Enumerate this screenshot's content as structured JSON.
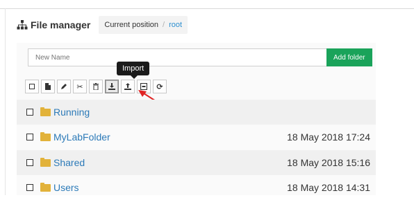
{
  "header": {
    "title": "File manager",
    "breadcrumb": {
      "label": "Current position",
      "separator": "/",
      "current": "root"
    }
  },
  "new_folder": {
    "placeholder": "New Name",
    "button_label": "Add folder"
  },
  "toolbar": {
    "tooltip": "Import",
    "buttons": [
      {
        "icon": "checkbox-icon"
      },
      {
        "icon": "new-file-icon"
      },
      {
        "icon": "pencil-icon"
      },
      {
        "icon": "scissors-icon"
      },
      {
        "icon": "trash-icon"
      },
      {
        "icon": "import-icon"
      },
      {
        "icon": "export-icon"
      },
      {
        "icon": "archive-icon"
      },
      {
        "icon": "refresh-icon"
      }
    ]
  },
  "files": [
    {
      "name": "Running",
      "date": ""
    },
    {
      "name": "MyLabFolder",
      "date": "18 May 2018 17:24"
    },
    {
      "name": "Shared",
      "date": "18 May 2018 15:16"
    },
    {
      "name": "Users",
      "date": "18 May 2018 14:31"
    }
  ],
  "colors": {
    "accent_green": "#1aa35a",
    "link_blue": "#2c7ab8",
    "folder_yellow": "#e2b23a",
    "arrow_red": "#e02424"
  }
}
